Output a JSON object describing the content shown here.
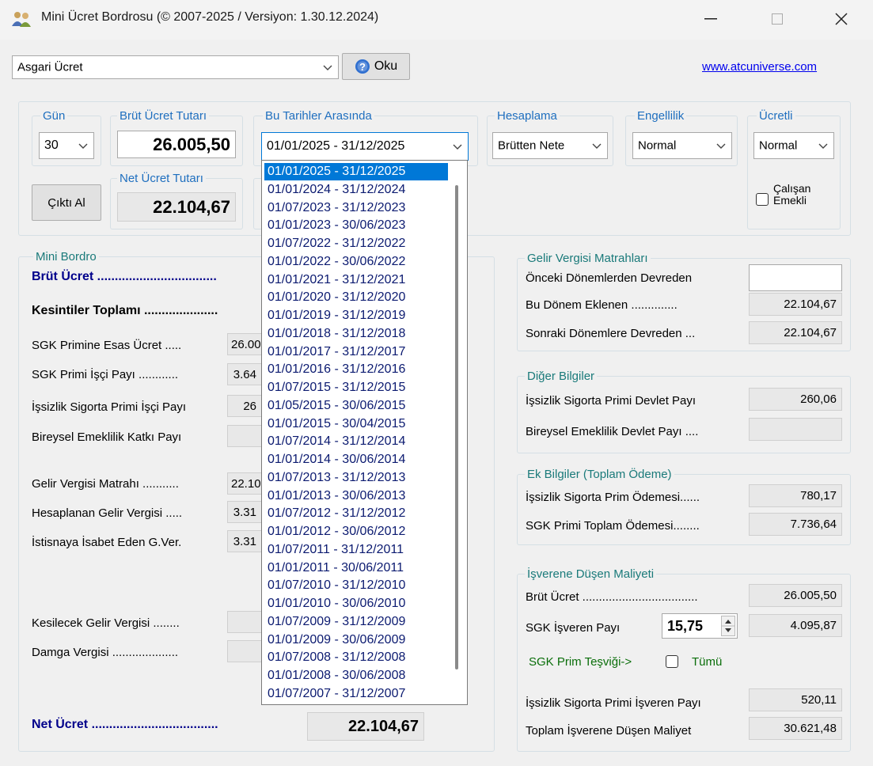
{
  "window": {
    "title": "Mini Ücret Bordrosu (© 2007-2025 / Versiyon: 1.30.12.2024)",
    "minimize": "—",
    "maximize": "☐",
    "close": "✕"
  },
  "toolbar": {
    "preset_value": "Asgari Ücret",
    "read_button": "Oku",
    "website": "www.atcuniverse.com"
  },
  "params": {
    "gun_label": "Gün",
    "gun_value": "30",
    "brut_label": "Brüt Ücret Tutarı",
    "brut_value": "26.005,50",
    "net_label": "Net Ücret Tutarı",
    "net_value": "22.104,67",
    "tarih_label": "Bu Tarihler Arasında",
    "tarih_value": "01/01/2025 - 31/12/2025",
    "hesaplama_label": "Hesaplama",
    "hesaplama_value": "Brütten Nete",
    "engellilik_label": "Engellilik",
    "engellilik_value": "Normal",
    "ucretli_label": "Ücretli",
    "ucretli_value": "Normal",
    "cikti_button": "Çıktı Al",
    "calisan_emekli_1": "Çalışan",
    "calisan_emekli_2": "Emekli"
  },
  "date_options": [
    "01/01/2025 - 31/12/2025",
    "01/01/2024 - 31/12/2024",
    "01/07/2023 - 31/12/2023",
    "01/01/2023 - 30/06/2023",
    "01/07/2022 - 31/12/2022",
    "01/01/2022 - 30/06/2022",
    "01/01/2021 - 31/12/2021",
    "01/01/2020 - 31/12/2020",
    "01/01/2019 - 31/12/2019",
    "01/01/2018 - 31/12/2018",
    "01/01/2017 - 31/12/2017",
    "01/01/2016 - 31/12/2016",
    "01/07/2015 - 31/12/2015",
    "01/05/2015 - 30/06/2015",
    "01/01/2015 - 30/04/2015",
    "01/07/2014 - 31/12/2014",
    "01/01/2014 - 30/06/2014",
    "01/07/2013 - 31/12/2013",
    "01/01/2013 - 30/06/2013",
    "01/07/2012 - 31/12/2012",
    "01/01/2012 - 30/06/2012",
    "01/07/2011 - 31/12/2011",
    "01/01/2011 - 30/06/2011",
    "01/07/2010 - 31/12/2010",
    "01/01/2010 - 30/06/2010",
    "01/07/2009 - 31/12/2009",
    "01/01/2009 - 30/06/2009",
    "01/07/2008 - 31/12/2008",
    "01/01/2008 - 30/06/2008",
    "01/07/2007 - 31/12/2007"
  ],
  "mini_bordro": {
    "title": "Mini Bordro",
    "brut_ucret": "Brüt Ücret ..................................",
    "kesintiler": "Kesintiler Toplamı .....................",
    "sgk_esas": "SGK Primine Esas Ücret .....",
    "sgk_esas_value": "26.00",
    "sgk_isci": "SGK Primi İşçi Payı ............",
    "sgk_isci_value": "3.64",
    "issizlik_isci": "İşsizlik Sigorta Primi İşçi Payı",
    "issizlik_isci_value": "26",
    "bes": "Bireysel Emeklilik Katkı Payı",
    "gv_matrah": "Gelir Vergisi Matrahı ...........",
    "gv_matrah_value": "22.10",
    "hesaplanan_gv": "Hesaplanan Gelir Vergisi .....",
    "hesaplanan_gv_value": "3.31",
    "istisna": "İstisnaya İsabet Eden G.Ver.",
    "istisna_value": "3.31",
    "kesilecek_gv": "Kesilecek Gelir Vergisi ........",
    "damga": "Damga Vergisi ....................",
    "net_ucret": "Net Ücret ....................................",
    "net_ucret_value": "22.104,67"
  },
  "gv_matrahlari": {
    "title": "Gelir Vergisi Matrahları",
    "onceki": "Önceki Dönemlerden Devreden",
    "onceki_value": "",
    "bu_donem": "Bu Dönem Eklenen ..............",
    "bu_donem_value": "22.104,67",
    "sonraki": "Sonraki Dönemlere Devreden ...",
    "sonraki_value": "22.104,67"
  },
  "diger": {
    "title": "Diğer Bilgiler",
    "issizlik_devlet": "İşsizlik Sigorta Primi Devlet Payı",
    "issizlik_devlet_value": "260,06",
    "bes_devlet": "Bireysel Emeklilik Devlet Payı ....",
    "bes_devlet_value": ""
  },
  "ek": {
    "title": "Ek Bilgiler (Toplam Ödeme)",
    "issizlik_odeme": "İşsizlik Sigorta Prim Ödemesi......",
    "issizlik_odeme_value": "780,17",
    "sgk_odeme": "SGK Primi Toplam Ödemesi........",
    "sgk_odeme_value": "7.736,64"
  },
  "isveren": {
    "title": "İşverene Düşen Maliyeti",
    "brut": "Brüt Ücret ...................................",
    "brut_value": "26.005,50",
    "sgk_isveren": "SGK İşveren Payı",
    "sgk_rate": "15,75",
    "sgk_isveren_value": "4.095,87",
    "tesvik": "SGK Prim Teşviği->",
    "tumu": "Tümü",
    "issizlik_isveren": "İşsizlik Sigorta Primi İşveren Payı",
    "issizlik_isveren_value": "520,11",
    "toplam": "Toplam İşverene Düşen Maliyet",
    "toplam_value": "30.621,48"
  },
  "colors": {
    "accent": "#0078d7",
    "group_title": "#1f6fbf",
    "bold_label": "#00008b",
    "link": "#0000ee"
  }
}
